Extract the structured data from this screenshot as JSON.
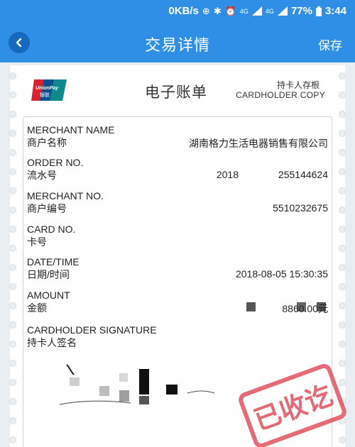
{
  "status_bar": {
    "speed": "0KB/s",
    "network_a": "4G",
    "network_b": "4G",
    "battery": "77%",
    "time": "3:44",
    "icons": [
      "data-saver-icon",
      "bluetooth-icon",
      "alarm-icon",
      "signal-icon",
      "battery-icon"
    ]
  },
  "app_bar": {
    "title": "交易详情",
    "save_label": "保存",
    "back_icon": "chevron-left-icon"
  },
  "receipt": {
    "logo_text": "UnionPay 银联",
    "title": "电子账单",
    "copy_label_cn": "持卡人存根",
    "copy_label_en": "CARDHOLDER COPY",
    "fields": [
      {
        "en": "MERCHANT NAME",
        "cn": "商户名称",
        "value": "湖南格力生活电器销售有限公司"
      },
      {
        "en": "ORDER NO.",
        "cn": "流水号",
        "value_a": "2018",
        "value_b": "255144624"
      },
      {
        "en": "MERCHANT NO.",
        "cn": "商户编号",
        "value": "5510232675"
      },
      {
        "en": "CARD NO.",
        "cn": "卡号",
        "value": ""
      },
      {
        "en": "DATE/TIME",
        "cn": "日期/时间",
        "value": "2018-08-05 15:30:35"
      },
      {
        "en": "AMOUNT",
        "cn": "金额",
        "value": "8860.00元"
      },
      {
        "en": "CARDHOLDER SIGNATURE",
        "cn": "持卡人签名",
        "value": ""
      }
    ],
    "stamp_text": "已收讫",
    "colors": {
      "primary": "#2f8fe6",
      "stamp": "#e0525f",
      "unionpay_red": "#d6232f",
      "unionpay_blue": "#0a6aa6"
    }
  }
}
